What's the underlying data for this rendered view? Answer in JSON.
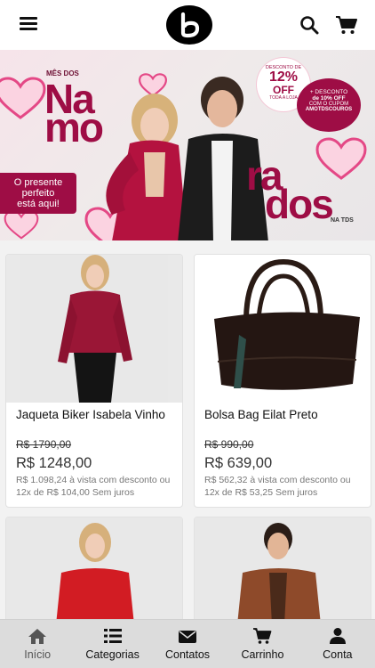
{
  "header": {
    "logo_letter": "b"
  },
  "banner": {
    "small_top": "MÊS DOS",
    "word1": "Na",
    "word2": "mo",
    "word3": "ra",
    "word4": "dos",
    "tds": "NA TDS",
    "discount_top": "DESCONTO DE",
    "discount_value": "12%",
    "discount_off": "OFF",
    "discount_sub": "TODA A LOJA",
    "coupon_line1": "+ DESCONTO",
    "coupon_line2": "de 10% OFF",
    "coupon_line3": "COM O CUPOM",
    "coupon_code": "AMOTDSCOUROS",
    "gift_line1": "O presente",
    "gift_line2": "perfeito",
    "gift_line3": "está aqui!"
  },
  "products": [
    {
      "name": "Jaqueta Biker Isabela Vinho",
      "old_price": "R$ 1790,00",
      "price": "R$ 1248,00",
      "info": "R$ 1.098,24 à vista com desconto ou 12x de R$ 104,00 Sem juros"
    },
    {
      "name": "Bolsa Bag Eilat Preto",
      "old_price": "R$ 990,00",
      "price": "R$ 639,00",
      "info": "R$ 562,32 à vista com desconto ou 12x de R$ 53,25 Sem juros"
    },
    {
      "name": "",
      "old_price": "",
      "price": "",
      "info": ""
    },
    {
      "name": "",
      "old_price": "",
      "price": "",
      "info": ""
    }
  ],
  "nav": [
    {
      "label": "Início",
      "icon": "home-icon"
    },
    {
      "label": "Categorias",
      "icon": "list-icon"
    },
    {
      "label": "Contatos",
      "icon": "envelope-icon"
    },
    {
      "label": "Carrinho",
      "icon": "cart-icon"
    },
    {
      "label": "Conta",
      "icon": "user-icon"
    }
  ],
  "colors": {
    "brand": "#9e0d45",
    "nav_bg": "#dcdcdc"
  }
}
